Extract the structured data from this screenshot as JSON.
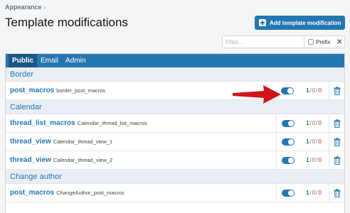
{
  "breadcrumb": {
    "items": [
      "Appearance"
    ],
    "separator": "›"
  },
  "page": {
    "title": "Template modifications"
  },
  "actions": {
    "add_label": "Add template modification"
  },
  "filter": {
    "placeholder": "Filter...",
    "prefix_label": "Prefix",
    "clear_glyph": "✕"
  },
  "tabs": [
    {
      "label": "Public",
      "active": true
    },
    {
      "label": "Email",
      "active": false
    },
    {
      "label": "Admin",
      "active": false
    }
  ],
  "groups": [
    {
      "label": "Border",
      "rows": [
        {
          "title": "post_macros",
          "template": "border_post_macros",
          "enabled": true,
          "counts": {
            "ok": "1",
            "mid": "0",
            "err": "0"
          }
        }
      ]
    },
    {
      "label": "Calendar",
      "rows": [
        {
          "title": "thread_list_macros",
          "template": "Calendar_thread_list_macros",
          "enabled": true,
          "counts": {
            "ok": "1",
            "mid": "0",
            "err": "0"
          }
        },
        {
          "title": "thread_view",
          "template": "Calendar_thread_view_1",
          "enabled": true,
          "counts": {
            "ok": "1",
            "mid": "0",
            "err": "0"
          }
        },
        {
          "title": "thread_view",
          "template": "Calendar_thread_view_2",
          "enabled": true,
          "counts": {
            "ok": "1",
            "mid": "0",
            "err": "0"
          }
        }
      ]
    },
    {
      "label": "Change author",
      "rows": [
        {
          "title": "post_macros",
          "template": "ChangeAuthor_post_macros",
          "enabled": true,
          "counts": {
            "ok": "1",
            "mid": "0",
            "err": "0"
          }
        }
      ]
    }
  ],
  "colors": {
    "accent": "#2577b1",
    "ok": "#1f7a1f",
    "err": "#c72a2a",
    "arrow": "#d0141b"
  },
  "icons": {
    "add": "plus-square-icon",
    "delete": "trash-icon",
    "pointer": "red-arrow-icon"
  }
}
